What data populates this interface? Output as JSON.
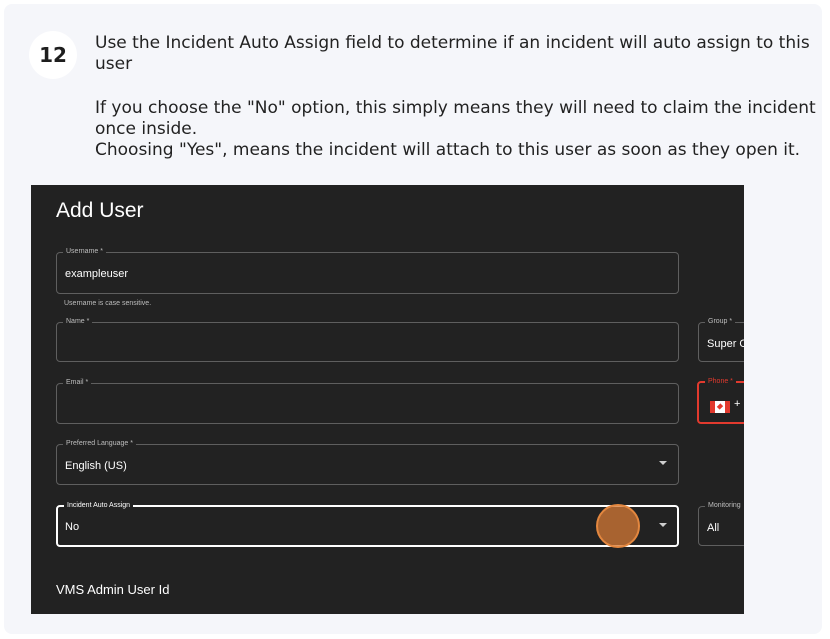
{
  "step": {
    "number": "12",
    "lines": [
      "Use the Incident Auto Assign field to determine if an incident will auto assign to this user",
      "If you choose the \"No\" option, this simply means they will need to claim the incident once inside.",
      "Choosing \"Yes\", means the incident will attach to this user as soon as they open it."
    ]
  },
  "dialog": {
    "title": "Add User",
    "username": {
      "label": "Username *",
      "value": "exampleuser",
      "helper": "Username is case sensitive."
    },
    "name": {
      "label": "Name *",
      "value": ""
    },
    "group": {
      "label": "Group *",
      "value": "Super O"
    },
    "email": {
      "label": "Email *",
      "value": ""
    },
    "phone": {
      "label": "Phone *",
      "prefix": "+"
    },
    "preferred_language": {
      "label": "Preferred Language *",
      "value": "English (US)"
    },
    "incident_auto_assign": {
      "label": "Incident Auto Assign",
      "value": "No"
    },
    "monitoring": {
      "label": "Monitoring",
      "value": "All"
    },
    "section_title": "VMS Admin User Id"
  },
  "icons": {
    "dropdown": "chevron-down-icon",
    "flag": "canada-flag-icon",
    "click": "click-indicator"
  },
  "colors": {
    "card_bg": "#f5f6fa",
    "dialog_bg": "#222222",
    "error": "#e23a2e",
    "click_marker": "#d67a36"
  }
}
